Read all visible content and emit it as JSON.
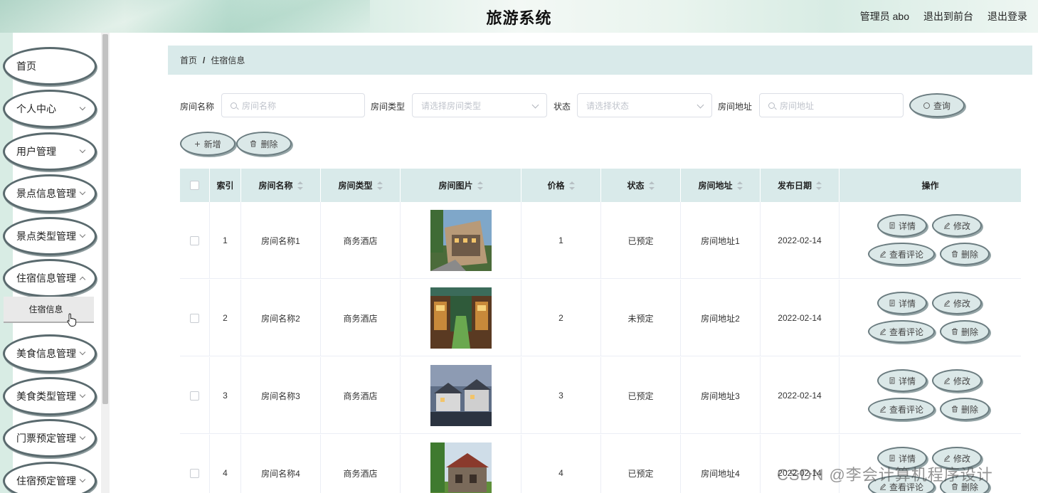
{
  "header": {
    "title": "旅游系统",
    "user_label": "管理员 abo",
    "to_front_label": "退出到前台",
    "logout_label": "退出登录"
  },
  "sidebar": {
    "items": [
      {
        "label": "首页",
        "has_children": false
      },
      {
        "label": "个人中心",
        "has_children": true
      },
      {
        "label": "用户管理",
        "has_children": true
      },
      {
        "label": "景点信息管理",
        "has_children": true
      },
      {
        "label": "景点类型管理",
        "has_children": true
      },
      {
        "label": "住宿信息管理",
        "has_children": true,
        "expanded": true
      },
      {
        "label": "美食信息管理",
        "has_children": true
      },
      {
        "label": "美食类型管理",
        "has_children": true
      },
      {
        "label": "门票预定管理",
        "has_children": true
      },
      {
        "label": "住宿预定管理",
        "has_children": true
      }
    ],
    "active_sub_item": "住宿信息"
  },
  "breadcrumb": {
    "home": "首页",
    "separator": "/",
    "current": "住宿信息"
  },
  "search": {
    "room_name_label": "房间名称",
    "room_name_placeholder": "房间名称",
    "room_type_label": "房间类型",
    "room_type_placeholder": "请选择房间类型",
    "status_label": "状态",
    "status_placeholder": "请选择状态",
    "address_label": "房间地址",
    "address_placeholder": "房间地址",
    "query_button": "查询"
  },
  "toolbar": {
    "add_button": "新增",
    "delete_button": "删除"
  },
  "table": {
    "columns": [
      "索引",
      "房间名称",
      "房间类型",
      "房间图片",
      "价格",
      "状态",
      "房间地址",
      "发布日期",
      "操作"
    ],
    "actions": {
      "detail": "详情",
      "edit": "修改",
      "review": "查看评论",
      "delete": "删除"
    },
    "rows": [
      {
        "index": "1",
        "name": "房间名称1",
        "type": "商务酒店",
        "price": "1",
        "status": "已预定",
        "address": "房间地址1",
        "date": "2022-02-14"
      },
      {
        "index": "2",
        "name": "房间名称2",
        "type": "商务酒店",
        "price": "2",
        "status": "未预定",
        "address": "房间地址2",
        "date": "2022-02-14"
      },
      {
        "index": "3",
        "name": "房间名称3",
        "type": "商务酒店",
        "price": "3",
        "status": "已预定",
        "address": "房间地址3",
        "date": "2022-02-14"
      },
      {
        "index": "4",
        "name": "房间名称4",
        "type": "商务酒店",
        "price": "4",
        "status": "已预定",
        "address": "房间地址4",
        "date": "2022-02-14"
      }
    ]
  },
  "watermark": "CSDN @李会计算机程序设计",
  "colors": {
    "header_bg": "#d8ece4",
    "table_head_bg": "#d9eaea",
    "pill_bg": "#dbe8e8",
    "pill_border": "#6b7c80"
  }
}
